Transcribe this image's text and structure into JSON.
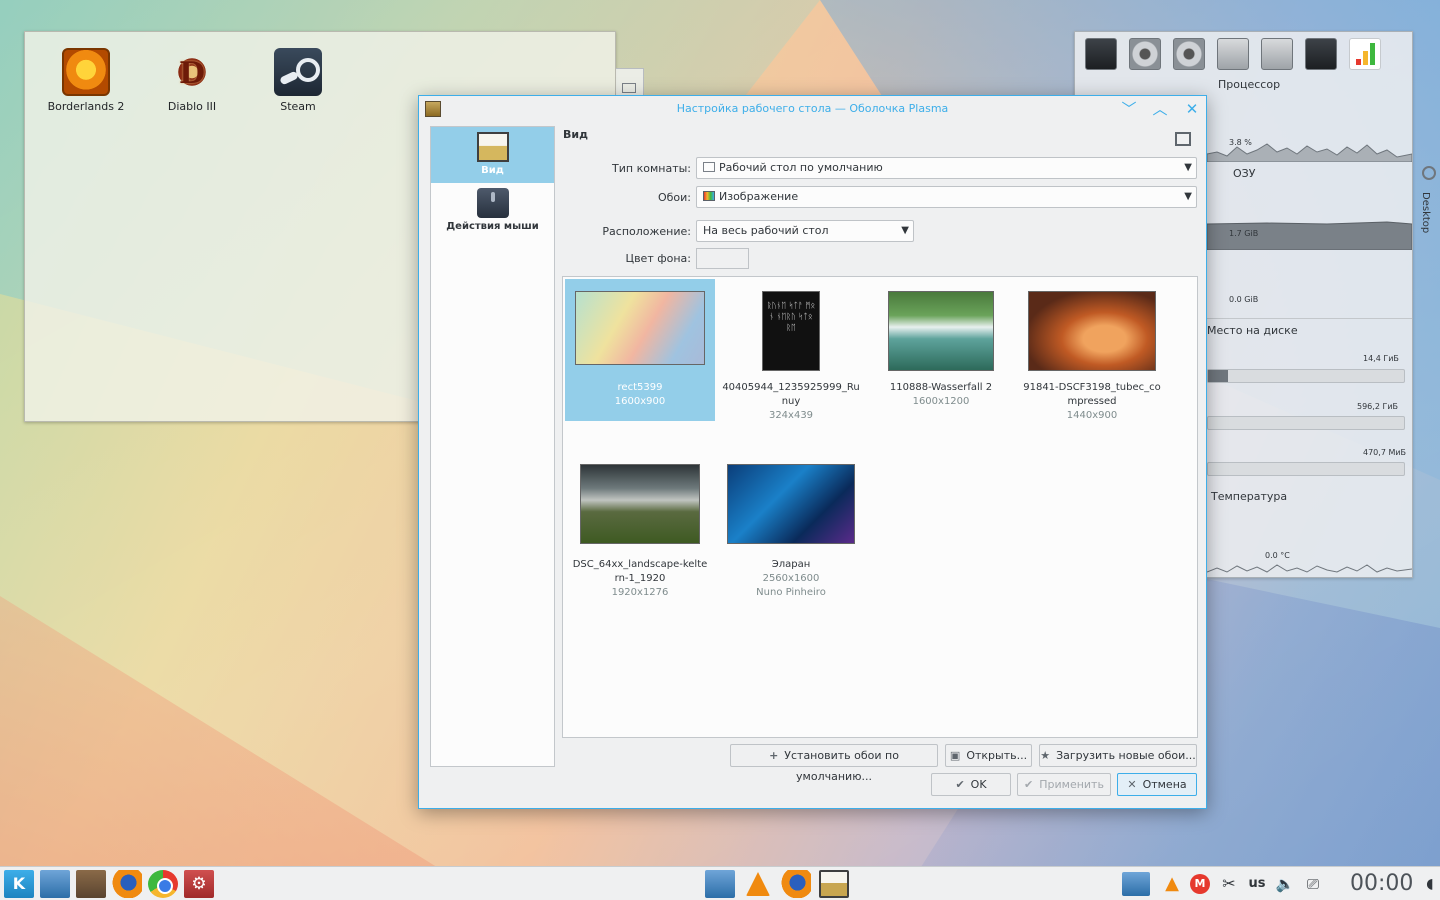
{
  "desktop": {
    "icons": [
      {
        "label": "Borderlands 2"
      },
      {
        "label": "Diablo III"
      },
      {
        "label": "Steam"
      }
    ]
  },
  "sysmon": {
    "cpu_title": "Процессор",
    "cpu_value": "3.8 %",
    "ram_title": "ОЗУ",
    "ram_used": "1.7 GiB",
    "swap_used": "0.0 GiB",
    "disk_title": "Место на диске",
    "disks": [
      {
        "value": "14,4 ГиБ",
        "fill": 0.1
      },
      {
        "value": "596,2 ГиБ",
        "fill": 0.0
      },
      {
        "value": "470,7 МиБ",
        "fill": 0.0
      }
    ],
    "temp_title": "Температура",
    "temp_value": "0.0 °C",
    "side_label": "Desktop"
  },
  "dialog": {
    "title": "Настройка рабочего стола — Оболочка Plasma",
    "sidebar": [
      {
        "label": "Вид",
        "active": true
      },
      {
        "label": "Действия мыши",
        "active": false
      }
    ],
    "section_title": "Вид",
    "fields": {
      "layout_label": "Тип комнаты:",
      "layout_value": "Рабочий стол по умолчанию",
      "wallpaper_label": "Обои:",
      "wallpaper_value": "Изображение",
      "position_label": "Расположение:",
      "position_value": "На весь рабочий стол",
      "bgcolor_label": "Цвет фона:"
    },
    "wallpapers": [
      {
        "name": "rect5399",
        "size": "1600x900",
        "author": ""
      },
      {
        "name": "40405944_1235925999_Runuy",
        "size": "324x439",
        "author": ""
      },
      {
        "name": "110888-Wasserfall 2",
        "size": "1600x1200",
        "author": ""
      },
      {
        "name": "91841-DSCF3198_tubec_compressed",
        "size": "1440x900",
        "author": ""
      },
      {
        "name": "DSC_64xx_landscape-keltern-1_1920",
        "size": "1920x1276",
        "author": ""
      },
      {
        "name": "Эларан",
        "size": "2560x1600",
        "author": "Nuno Pinheiro"
      }
    ],
    "buttons": {
      "set_default": "Установить обои по умолчанию...",
      "open": "Открыть...",
      "get_new": "Загрузить новые обои...",
      "ok": "OK",
      "apply": "Применить",
      "cancel": "Отмена"
    }
  },
  "taskbar": {
    "kbd_layout": "us",
    "clock": "00:00"
  }
}
